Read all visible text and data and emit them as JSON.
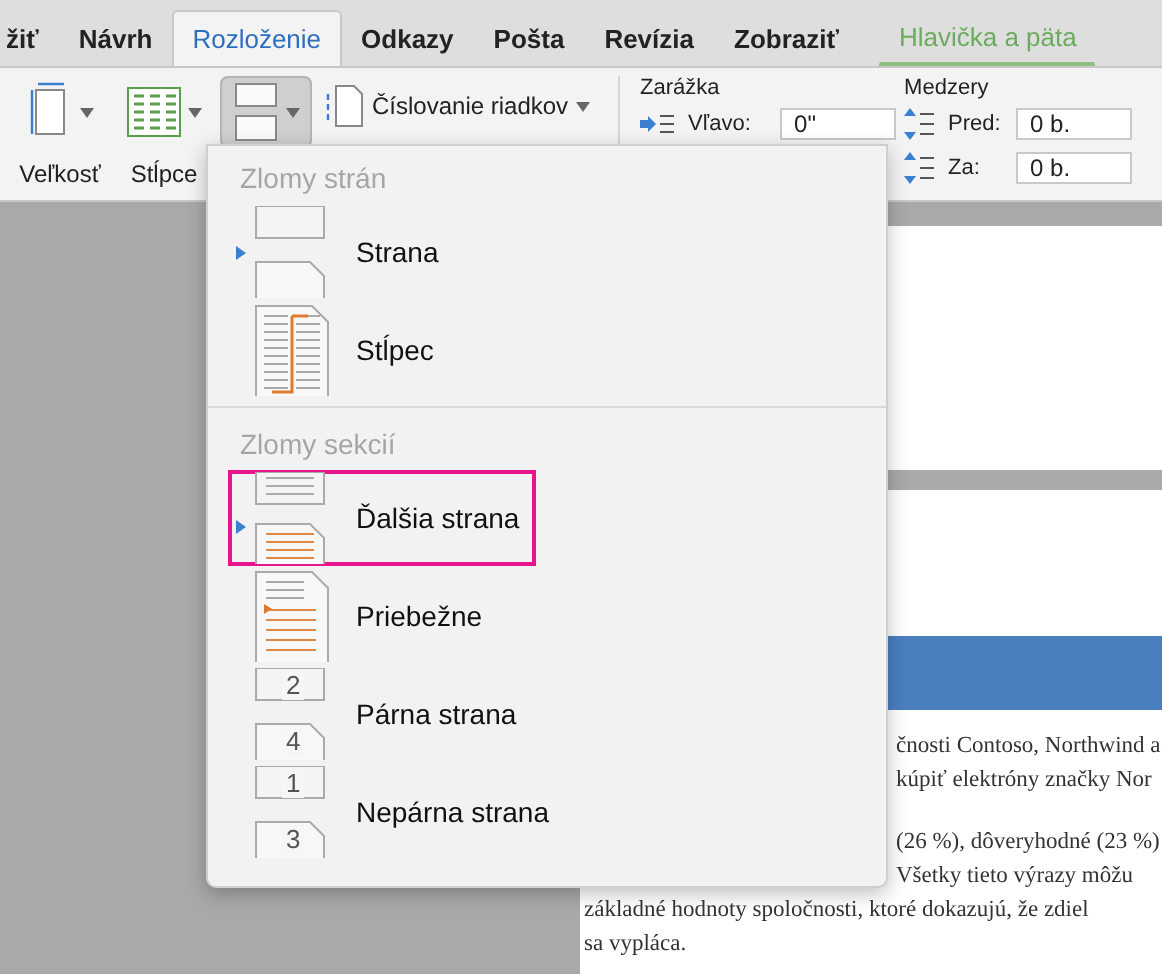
{
  "tabs": [
    {
      "label": "žiť",
      "selected": false,
      "kind": "normal"
    },
    {
      "label": "Návrh",
      "selected": false,
      "kind": "normal"
    },
    {
      "label": "Rozloženie",
      "selected": true,
      "kind": "normal"
    },
    {
      "label": "Odkazy",
      "selected": false,
      "kind": "normal"
    },
    {
      "label": "Pošta",
      "selected": false,
      "kind": "normal"
    },
    {
      "label": "Revízia",
      "selected": false,
      "kind": "normal"
    },
    {
      "label": "Zobraziť",
      "selected": false,
      "kind": "normal"
    },
    {
      "label": "Hlavička a päta",
      "selected": false,
      "kind": "contextual"
    }
  ],
  "ribbon": {
    "buttons": [
      {
        "label": "Veľkosť",
        "kind": "size"
      },
      {
        "label": "Stĺpce",
        "kind": "columns"
      }
    ],
    "breaks_button": {
      "pressed": true
    },
    "line_numbers": {
      "label": "Číslovanie riadkov"
    },
    "indent": {
      "title": "Zarážka",
      "fields": [
        {
          "label": "Vľavo:",
          "value": "0\""
        }
      ]
    },
    "spacing": {
      "title": "Medzery",
      "fields": [
        {
          "label": "Pred:",
          "value": "0 b."
        },
        {
          "label": "Za:",
          "value": "0 b."
        }
      ]
    }
  },
  "breaks_menu": {
    "sections": [
      {
        "heading": "Zlomy strán",
        "items": [
          {
            "label": "Strana",
            "kind": "page",
            "selected": false
          },
          {
            "label": "Stĺpec",
            "kind": "column",
            "selected": false
          }
        ]
      },
      {
        "heading": "Zlomy sekcií",
        "items": [
          {
            "label": "Ďalšia strana",
            "kind": "next",
            "selected": true
          },
          {
            "label": "Priebežne",
            "kind": "continuous",
            "selected": false
          },
          {
            "label": "Párna strana",
            "kind": "numbered",
            "numbers": [
              "2",
              "4"
            ],
            "selected": false
          },
          {
            "label": "Nepárna strana",
            "kind": "numbered",
            "numbers": [
              "1",
              "3"
            ],
            "selected": false
          }
        ]
      }
    ]
  },
  "document": {
    "partial_lines": [
      "čnosti Contoso, Northwind a",
      "kúpiť elektróny značky Nor",
      "(26 %), dôveryhodné (23 %)",
      "Všetky tieto výrazy môžu"
    ],
    "lines": [
      "základné hodnoty spoločnosti, ktoré dokazujú, že zdiel",
      "sa vypláca."
    ]
  }
}
